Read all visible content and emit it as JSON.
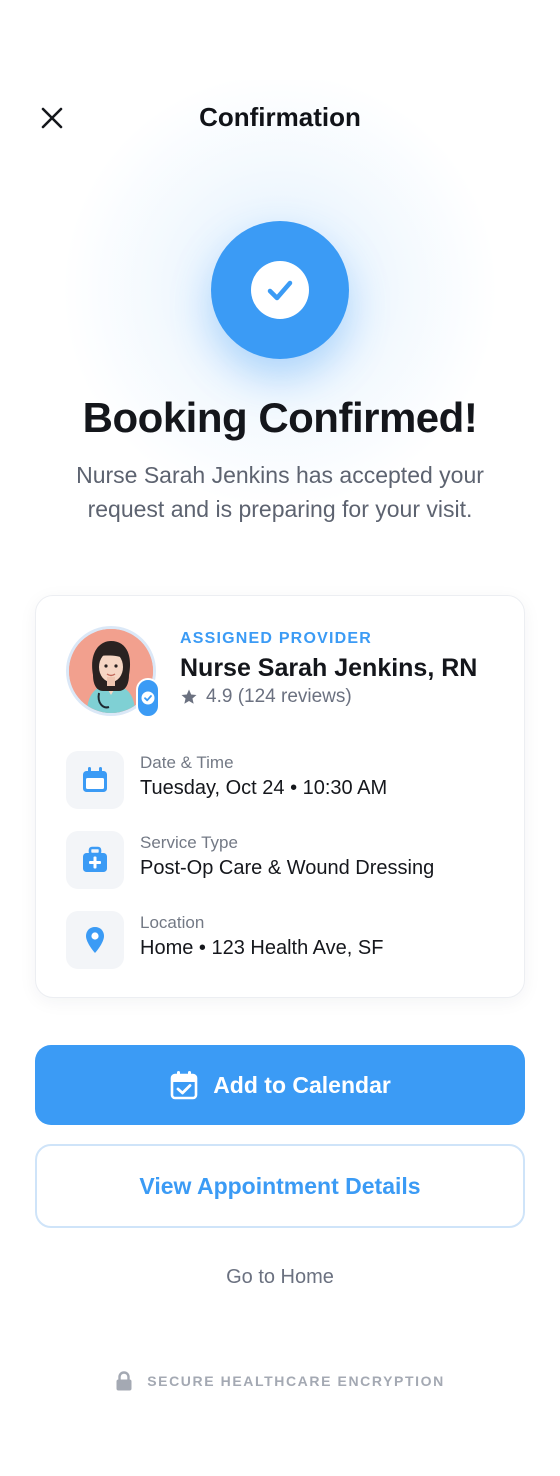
{
  "header": {
    "title": "Confirmation"
  },
  "hero": {
    "headline": "Booking Confirmed!",
    "message": "Nurse Sarah Jenkins has accepted your request and is preparing for your visit."
  },
  "provider": {
    "kicker": "ASSIGNED PROVIDER",
    "name": "Nurse Sarah Jenkins, RN",
    "rating": "4.9 (124 reviews)"
  },
  "details": [
    {
      "icon": "calendar-icon",
      "label": "Date & Time",
      "value": "Tuesday, Oct 24 • 10:30 AM"
    },
    {
      "icon": "medical-kit-icon",
      "label": "Service Type",
      "value": "Post-Op Care & Wound Dressing"
    },
    {
      "icon": "location-pin-icon",
      "label": "Location",
      "value": "Home • 123 Health Ave, SF"
    }
  ],
  "actions": {
    "primary": "Add to Calendar",
    "secondary": "View Appointment Details",
    "tertiary": "Go to Home"
  },
  "footer": {
    "secure_label": "SECURE HEALTHCARE ENCRYPTION"
  },
  "colors": {
    "accent": "#3b9bf5",
    "text_primary": "#14161b",
    "text_secondary": "#6b7180"
  }
}
